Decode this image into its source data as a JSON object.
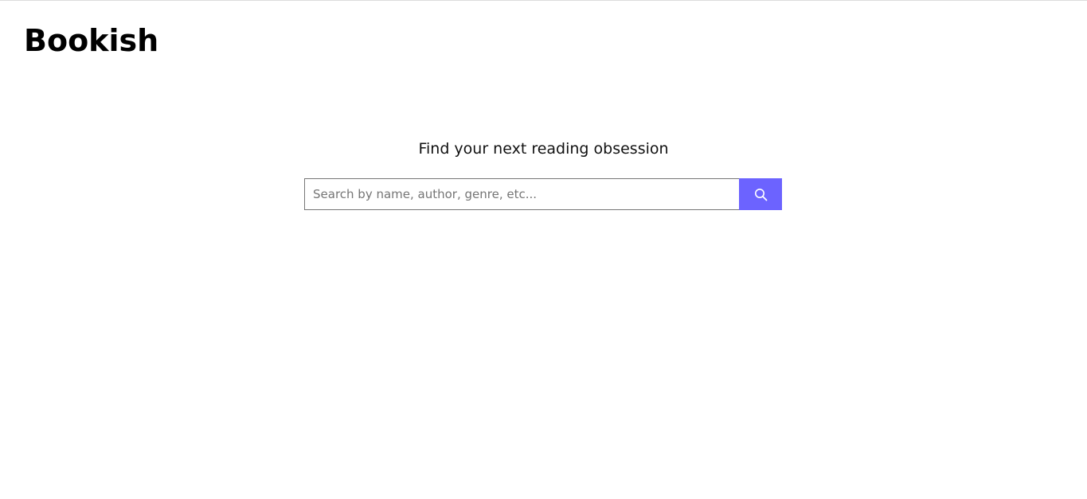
{
  "header": {
    "logo_text": "Bookish"
  },
  "hero": {
    "tagline": "Find your next reading obsession"
  },
  "search": {
    "placeholder": "Search by name, author, genre, etc...",
    "value": "",
    "button_icon": "search-icon"
  },
  "colors": {
    "accent": "#6c63ff",
    "icon": "#ffffff"
  }
}
